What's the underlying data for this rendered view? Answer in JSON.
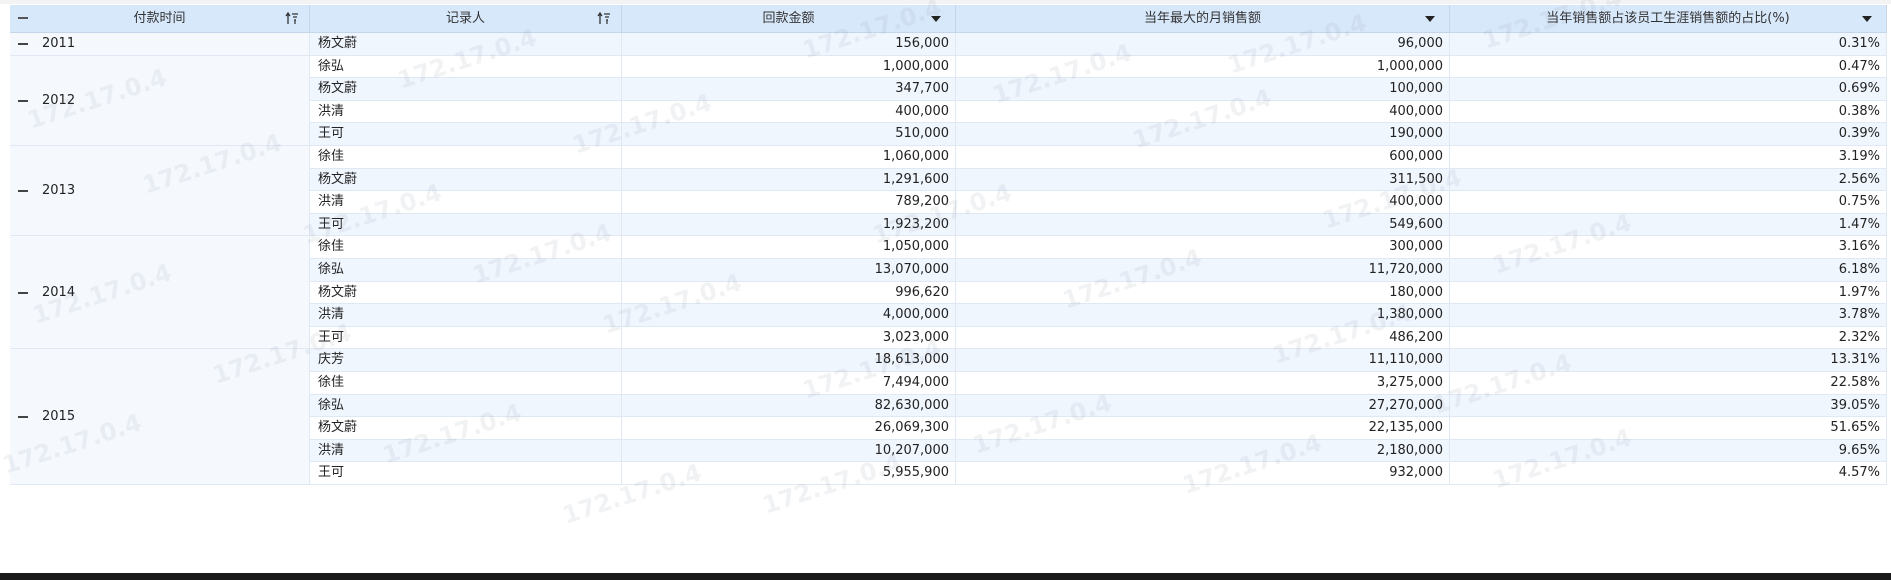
{
  "header": {
    "col_time": "付款时间",
    "col_recorder": "记录人",
    "col_amount": "回款金额",
    "col_max_month": "当年最大的月销售额",
    "col_ratio": "当年销售额占该员工生涯销售额的占比(%)"
  },
  "watermark": "172.17.0.4",
  "groups": [
    {
      "year": "2011",
      "rows": [
        {
          "recorder": "杨文蔚",
          "amount": "156,000",
          "max_month": "96,000",
          "ratio": "0.31%"
        }
      ]
    },
    {
      "year": "2012",
      "rows": [
        {
          "recorder": "徐弘",
          "amount": "1,000,000",
          "max_month": "1,000,000",
          "ratio": "0.47%"
        },
        {
          "recorder": "杨文蔚",
          "amount": "347,700",
          "max_month": "100,000",
          "ratio": "0.69%"
        },
        {
          "recorder": "洪清",
          "amount": "400,000",
          "max_month": "400,000",
          "ratio": "0.38%"
        },
        {
          "recorder": "王可",
          "amount": "510,000",
          "max_month": "190,000",
          "ratio": "0.39%"
        }
      ]
    },
    {
      "year": "2013",
      "rows": [
        {
          "recorder": "徐佳",
          "amount": "1,060,000",
          "max_month": "600,000",
          "ratio": "3.19%"
        },
        {
          "recorder": "杨文蔚",
          "amount": "1,291,600",
          "max_month": "311,500",
          "ratio": "2.56%"
        },
        {
          "recorder": "洪清",
          "amount": "789,200",
          "max_month": "400,000",
          "ratio": "0.75%"
        },
        {
          "recorder": "王可",
          "amount": "1,923,200",
          "max_month": "549,600",
          "ratio": "1.47%"
        }
      ]
    },
    {
      "year": "2014",
      "rows": [
        {
          "recorder": "徐佳",
          "amount": "1,050,000",
          "max_month": "300,000",
          "ratio": "3.16%"
        },
        {
          "recorder": "徐弘",
          "amount": "13,070,000",
          "max_month": "11,720,000",
          "ratio": "6.18%"
        },
        {
          "recorder": "杨文蔚",
          "amount": "996,620",
          "max_month": "180,000",
          "ratio": "1.97%"
        },
        {
          "recorder": "洪清",
          "amount": "4,000,000",
          "max_month": "1,380,000",
          "ratio": "3.78%"
        },
        {
          "recorder": "王可",
          "amount": "3,023,000",
          "max_month": "486,200",
          "ratio": "2.32%"
        }
      ]
    },
    {
      "year": "2015",
      "rows": [
        {
          "recorder": "庆芳",
          "amount": "18,613,000",
          "max_month": "11,110,000",
          "ratio": "13.31%"
        },
        {
          "recorder": "徐佳",
          "amount": "7,494,000",
          "max_month": "3,275,000",
          "ratio": "22.58%"
        },
        {
          "recorder": "徐弘",
          "amount": "82,630,000",
          "max_month": "27,270,000",
          "ratio": "39.05%"
        },
        {
          "recorder": "杨文蔚",
          "amount": "26,069,300",
          "max_month": "22,135,000",
          "ratio": "51.65%"
        },
        {
          "recorder": "洪清",
          "amount": "10,207,000",
          "max_month": "2,180,000",
          "ratio": "9.65%"
        },
        {
          "recorder": "王可",
          "amount": "5,955,900",
          "max_month": "932,000",
          "ratio": "4.57%"
        }
      ]
    }
  ]
}
